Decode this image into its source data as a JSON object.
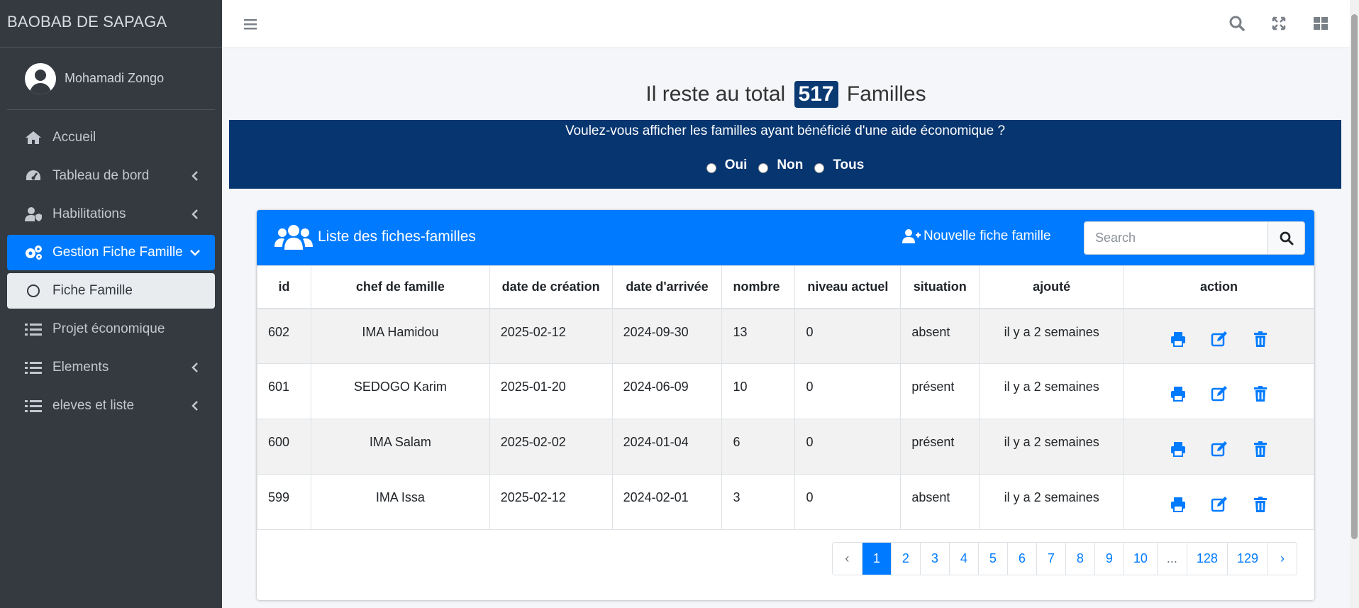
{
  "app": {
    "brand": "BAOBAB DE SAPAGA"
  },
  "user": {
    "name": "Mohamadi Zongo"
  },
  "sidebar": {
    "items": [
      {
        "label": "Accueil",
        "icon": "home-icon"
      },
      {
        "label": "Tableau de bord",
        "icon": "tachometer-icon"
      },
      {
        "label": "Habilitations",
        "icon": "user-shield-icon"
      },
      {
        "label": "Gestion Fiche Famille",
        "icon": "cogs-icon"
      },
      {
        "label": "Fiche Famille",
        "icon": "circle-icon"
      },
      {
        "label": "Projet économique",
        "icon": "list-icon"
      },
      {
        "label": "Elements",
        "icon": "list-icon"
      },
      {
        "label": "eleves et liste",
        "icon": "list-icon"
      }
    ]
  },
  "headline": {
    "prefix": "Il reste au total",
    "count": "517",
    "suffix": "Familles"
  },
  "banner": {
    "question": "Voulez-vous afficher les familles ayant bénéficié d'une aide économique ?",
    "options": [
      "Oui",
      "Non",
      "Tous"
    ]
  },
  "card": {
    "title": "Liste des fiches-familles",
    "new_button": "Nouvelle fiche famille",
    "search_placeholder": "Search"
  },
  "table": {
    "headers": [
      "id",
      "chef de famille",
      "date de création",
      "date d'arrivée",
      "nombre",
      "niveau actuel",
      "situation",
      "ajouté",
      "action"
    ],
    "rows": [
      [
        "602",
        "IMA Hamidou",
        "2025-02-12",
        "2024-09-30",
        "13",
        "0",
        "absent",
        "il y a 2 semaines"
      ],
      [
        "601",
        "SEDOGO Karim",
        "2025-01-20",
        "2024-06-09",
        "10",
        "0",
        "présent",
        "il y a 2 semaines"
      ],
      [
        "600",
        "IMA Salam",
        "2025-02-02",
        "2024-01-04",
        "6",
        "0",
        "présent",
        "il y a 2 semaines"
      ],
      [
        "599",
        "IMA Issa",
        "2025-02-12",
        "2024-02-01",
        "3",
        "0",
        "absent",
        "il y a 2 semaines"
      ]
    ]
  },
  "pagination": {
    "prev": "‹",
    "pages": [
      "1",
      "2",
      "3",
      "4",
      "5",
      "6",
      "7",
      "8",
      "9",
      "10",
      "...",
      "128",
      "129"
    ],
    "next": "›",
    "current": "1"
  },
  "colors": {
    "primary": "#007bff",
    "banner": "#063570",
    "sidebar": "#343a40"
  }
}
